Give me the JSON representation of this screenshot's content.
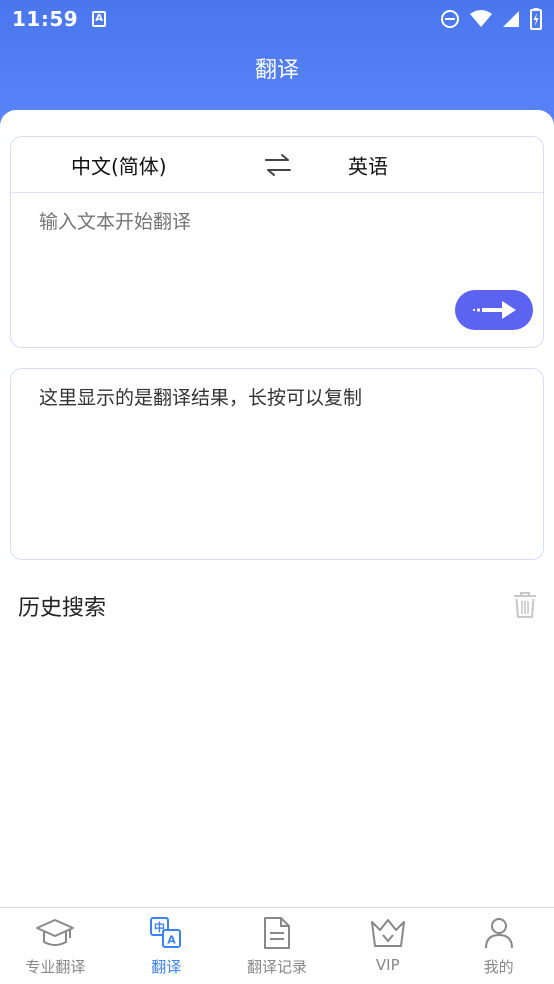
{
  "status_bar": {
    "time": "11:59",
    "notification_icon_letter": "A",
    "icons": [
      "do-not-disturb-icon",
      "wifi-icon",
      "signal-icon",
      "battery-icon"
    ]
  },
  "header": {
    "title": "翻译"
  },
  "translator": {
    "source_language": "中文(简体)",
    "target_language": "英语",
    "input_placeholder": "输入文本开始翻译",
    "result_placeholder": "这里显示的是翻译结果，长按可以复制"
  },
  "history": {
    "title": "历史搜索"
  },
  "bottom_nav": {
    "items": [
      {
        "label": "专业翻译",
        "icon": "graduation-cap-icon",
        "active": false
      },
      {
        "label": "翻译",
        "icon": "translate-icon",
        "active": true
      },
      {
        "label": "翻译记录",
        "icon": "document-icon",
        "active": false
      },
      {
        "label": "VIP",
        "icon": "crown-icon",
        "active": false
      },
      {
        "label": "我的",
        "icon": "user-icon",
        "active": false
      }
    ]
  },
  "colors": {
    "header_gradient_top": "#4a76ee",
    "header_gradient_bottom": "#5c87fb",
    "translate_button": "#5b63f0",
    "active_tab": "#3b82f6",
    "inactive_tab": "#888888",
    "card_border": "#d9dcff"
  }
}
